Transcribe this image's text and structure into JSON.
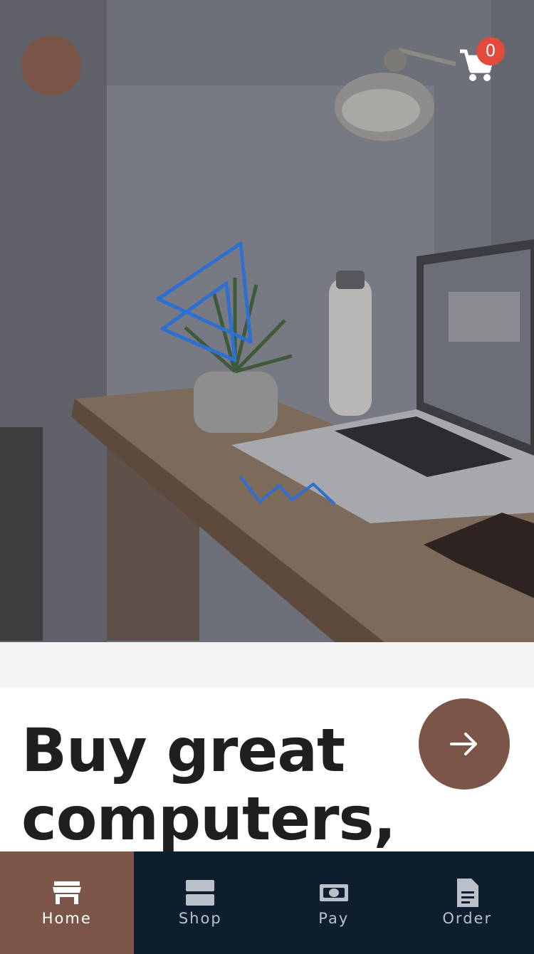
{
  "header": {
    "avatar_color": "#7a5548",
    "cart_icon": "shopping-cart-icon",
    "cart_count": "0",
    "badge_color": "#e24a3b"
  },
  "hero": {
    "image": "desk-with-laptop-plant-lamp-photo",
    "logo_color": "#2f6fd0"
  },
  "content": {
    "headline": "Buy great computers,",
    "cta_icon": "arrow-right-icon"
  },
  "tabbar": {
    "active_color": "#7a5548",
    "background_color": "#0f1e2e",
    "tabs": [
      {
        "label": "Home",
        "icon": "store-icon"
      },
      {
        "label": "Shop",
        "icon": "grid-icon"
      },
      {
        "label": "Pay",
        "icon": "money-icon"
      },
      {
        "label": "Order",
        "icon": "document-icon"
      }
    ]
  }
}
